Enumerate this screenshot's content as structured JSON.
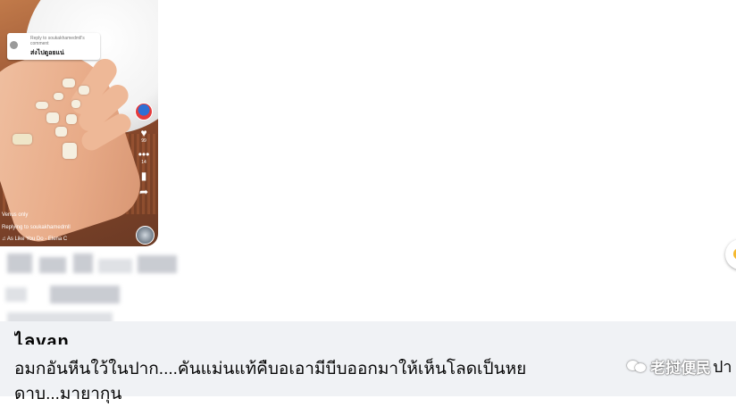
{
  "video": {
    "reply_card": {
      "header": "Reply to soukakhamedmll's comment",
      "text": "ส่งไปดูอยแน่"
    },
    "side_counts": {
      "likes": "99",
      "comments": "14"
    },
    "visibility": "Venus only",
    "replying_to_prefix": "Replying to",
    "replying_to_user": "soukakhamedmll",
    "music": "♫ As Like You Do - Elena C"
  },
  "comment": {
    "author": "ไลvan",
    "line1": "อมกอันหีนใว้ในปาก....คันแม่นแท้คืบอเอามีบีบออกมาให้เห็นโลดเป็นหย",
    "line2": "ดาบ...มายากุน"
  },
  "watermark": {
    "text": "老挝便民",
    "trailing": "ปา"
  }
}
